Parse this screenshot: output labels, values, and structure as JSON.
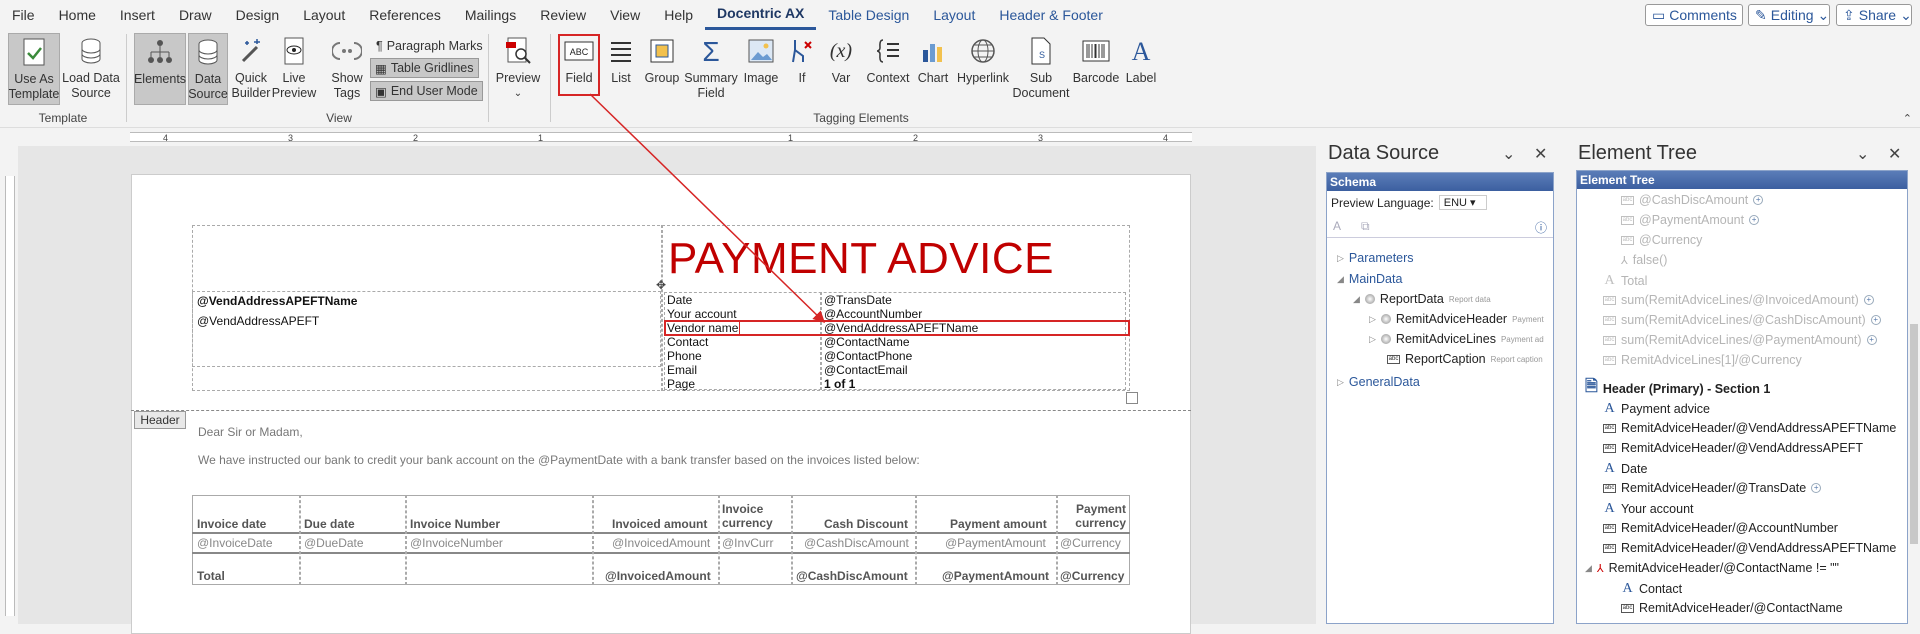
{
  "menu": {
    "items": [
      "File",
      "Home",
      "Insert",
      "Draw",
      "Design",
      "Layout",
      "References",
      "Mailings",
      "Review",
      "View",
      "Help",
      "Docentric AX",
      "Table Design",
      "Layout",
      "Header & Footer"
    ],
    "comments": "Comments",
    "editing": "Editing",
    "share": "Share"
  },
  "ribbon": {
    "use_as_template": "Use As Template",
    "load_data_source": "Load Data Source",
    "group_template": "Template",
    "elements": "Elements",
    "data_source": "Data Source",
    "quick_builder": "Quick Builder",
    "live_preview": "Live Preview",
    "show_tags": "Show Tags",
    "paragraph_marks": "Paragraph Marks",
    "table_gridlines": "Table Gridlines",
    "end_user_mode": "End User Mode",
    "group_view": "View",
    "preview": "Preview",
    "field": "Field",
    "list": "List",
    "group": "Group",
    "summary_field": "Summary Field",
    "image": "Image",
    "if": "If",
    "var": "Var",
    "context": "Context",
    "chart": "Chart",
    "hyperlink": "Hyperlink",
    "sub_document": "Sub Document",
    "barcode": "Barcode",
    "label": "Label",
    "group_tagging": "Tagging Elements"
  },
  "ruler": {
    "ticks": [
      "4",
      "3",
      "2",
      "1",
      "1",
      "2",
      "3",
      "4"
    ]
  },
  "document": {
    "title": "PAYMENT ADVICE",
    "vend_name": "@VendAddressAPEFTName",
    "vend_address": "@VendAddressAPEFT",
    "info_rows": [
      {
        "label": "Date",
        "value": "@TransDate"
      },
      {
        "label": "Your account",
        "value": "@AccountNumber"
      },
      {
        "label": "Vendor name",
        "value": "@VendAddressAPEFTName"
      },
      {
        "label": "Contact",
        "value": "@ContactName"
      },
      {
        "label": "Phone",
        "value": "@ContactPhone"
      },
      {
        "label": "Email",
        "value": "@ContactEmail"
      },
      {
        "label": "Page",
        "value": "1 of 1"
      }
    ],
    "header_tab": "Header",
    "greeting": "Dear Sir or Madam,",
    "body_text": "We have instructed our bank to credit your bank account on the @PaymentDate with a bank transfer based on the invoices listed below:",
    "table_headers": [
      "Invoice date",
      "Due date",
      "Invoice Number",
      "Invoiced amount",
      "Invoice currency",
      "Cash Discount",
      "Payment amount",
      "Payment currency"
    ],
    "table_row": [
      "@InvoiceDate",
      "@DueDate",
      "@InvoiceNumber",
      "@InvoicedAmount",
      "@InvCurr",
      "@CashDiscAmount",
      "@PaymentAmount",
      "@Currency"
    ],
    "total_row": [
      "Total",
      "",
      "",
      "@InvoicedAmount",
      "",
      "@CashDiscAmount",
      "@PaymentAmount",
      "@Currency"
    ]
  },
  "data_source": {
    "title": "Data Source",
    "schema": "Schema",
    "preview_language_label": "Preview Language:",
    "preview_language_value": "ENU",
    "parameters": "Parameters",
    "main_data": "MainData",
    "report_data": "ReportData",
    "report_data_sub": "Report data",
    "remit_header": "RemitAdviceHeader",
    "remit_header_sub": "Payment",
    "remit_lines": "RemitAdviceLines",
    "remit_lines_sub": "Payment ad",
    "report_caption": "ReportCaption",
    "report_caption_sub": "Report caption",
    "general_data": "GeneralData"
  },
  "element_tree": {
    "title": "Element Tree",
    "head": "Element Tree",
    "items": [
      "@CashDiscAmount",
      "@PaymentAmount",
      "@Currency",
      "false()",
      "Total",
      "sum(RemitAdviceLines/@InvoicedAmount)",
      "sum(RemitAdviceLines/@CashDiscAmount)",
      "sum(RemitAdviceLines/@PaymentAmount)",
      "RemitAdviceLines[1]/@Currency",
      "Header (Primary) - Section 1",
      "Payment advice",
      "RemitAdviceHeader/@VendAddressAPEFTName",
      "RemitAdviceHeader/@VendAddressAPEFT",
      "Date",
      "RemitAdviceHeader/@TransDate",
      "Your account",
      "RemitAdviceHeader/@AccountNumber",
      "RemitAdviceHeader/@VendAddressAPEFTName",
      "RemitAdviceHeader/@ContactName != \"\"",
      "Contact",
      "RemitAdviceHeader/@ContactName"
    ]
  },
  "colors": {
    "accent": "#2b579a",
    "title_red": "#c00000",
    "highlight_red": "#d62525"
  }
}
